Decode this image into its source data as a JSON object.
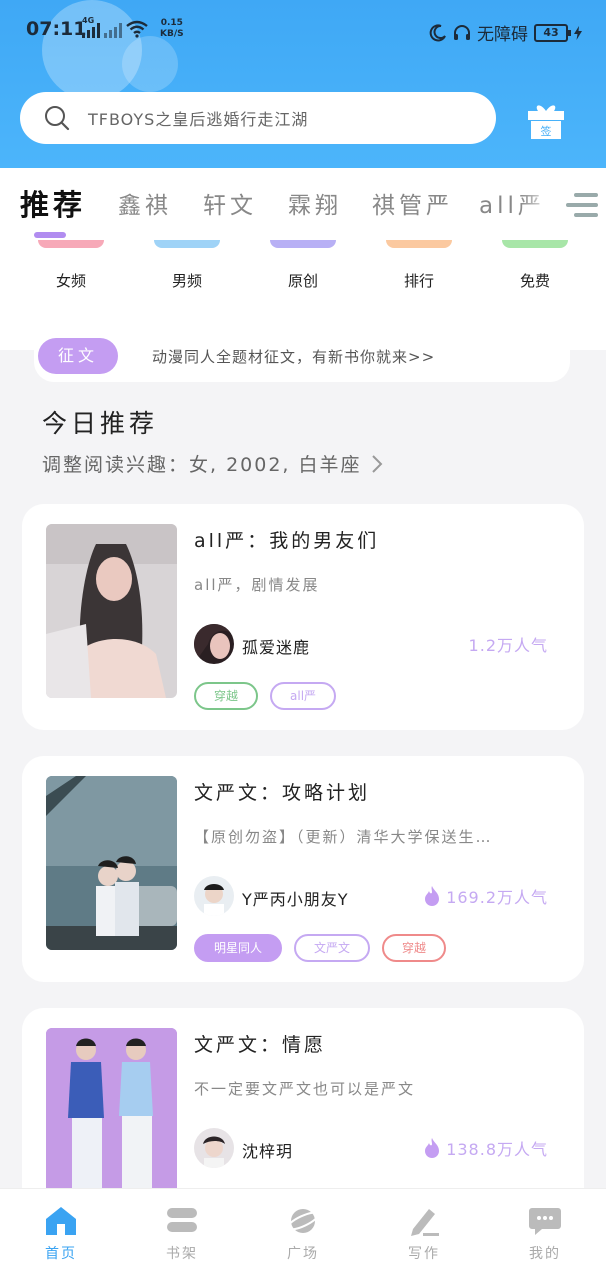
{
  "status_bar": {
    "time": "07:11",
    "network_type": "4G",
    "speed_value": "0.15",
    "speed_unit": "KB/S",
    "accessibility": "无障碍",
    "battery": "43"
  },
  "search": {
    "placeholder": "TFBOYS之皇后逃婚行走江湖"
  },
  "gift": {
    "label": "签"
  },
  "tabs": [
    "推荐",
    "鑫祺",
    "轩文",
    "霖翔",
    "祺管严",
    "all严"
  ],
  "categories": [
    {
      "label": "女频",
      "color": "#f7a9b8"
    },
    {
      "label": "男频",
      "color": "#9fd3f7"
    },
    {
      "label": "原创",
      "color": "#b8b0f5"
    },
    {
      "label": "排行",
      "color": "#fbc9a0"
    },
    {
      "label": "免费",
      "color": "#a8e6a8"
    }
  ],
  "notice": {
    "badge": "征文",
    "text": "动漫同人全题材征文，有新书你就来>>"
  },
  "section": {
    "title": "今日推荐",
    "subtitle": "调整阅读兴趣：女, 2002, 白羊座"
  },
  "books": [
    {
      "title": "all严：我的男友们",
      "desc": "all严，剧情发展",
      "author": "孤爱迷鹿",
      "popularity": "1.2万人气",
      "hot": false,
      "tags": [
        {
          "label": "穿越",
          "color": "#7cc68a"
        },
        {
          "label": "all严",
          "color": "#c5a9f2"
        }
      ]
    },
    {
      "title": "文严文：攻略计划",
      "desc": "【原创勿盗】（更新）清华大学保送生…",
      "author": "Y严丙小朋友Y",
      "popularity": "169.2万人气",
      "hot": true,
      "tags": [
        {
          "label": "明星同人",
          "color": "#c49df2",
          "filled": true
        },
        {
          "label": "文严文",
          "color": "#c5a9f2"
        },
        {
          "label": "穿越",
          "color": "#ef8a8a"
        }
      ]
    },
    {
      "title": "文严文：情愿",
      "desc": "不一定要文严文也可以是严文",
      "author": "沈梓玥",
      "popularity": "138.8万人气",
      "hot": true,
      "tags": []
    }
  ],
  "bottom_nav": [
    {
      "label": "首页",
      "icon": "home-icon",
      "active": true
    },
    {
      "label": "书架",
      "icon": "bookshelf-icon",
      "active": false
    },
    {
      "label": "广场",
      "icon": "planet-icon",
      "active": false
    },
    {
      "label": "写作",
      "icon": "pen-icon",
      "active": false
    },
    {
      "label": "我的",
      "icon": "chat-bubble-icon",
      "active": false
    }
  ],
  "colors": {
    "header_blue": "#43adf7",
    "accent_purple": "#c49df2",
    "nav_active": "#3aa3f2"
  }
}
